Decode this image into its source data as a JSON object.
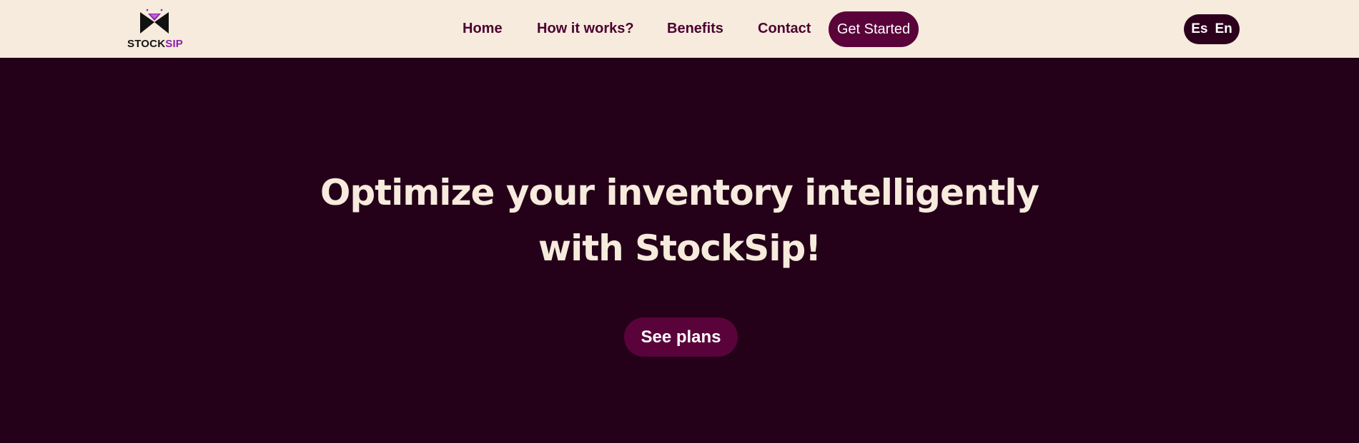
{
  "brand": {
    "name_part1": "STOCK",
    "name_part2": "SIP",
    "colors": {
      "header_bg": "#f6ebdc",
      "hero_bg": "#240019",
      "accent": "#5a033b",
      "nav_text": "#4b0231",
      "logo_sip": "#8b1fae"
    },
    "logo_icon": "bowtie-glass-icon"
  },
  "nav": {
    "items": [
      {
        "label": "Home"
      },
      {
        "label": "How it works?"
      },
      {
        "label": "Benefits"
      },
      {
        "label": "Contact"
      }
    ],
    "cta_label": "Get Started"
  },
  "language": {
    "options": [
      "Es",
      "En"
    ]
  },
  "hero": {
    "title_line1": "Optimize your inventory intelligently",
    "title_line2": "with StockSip!",
    "button_label": "See plans"
  }
}
